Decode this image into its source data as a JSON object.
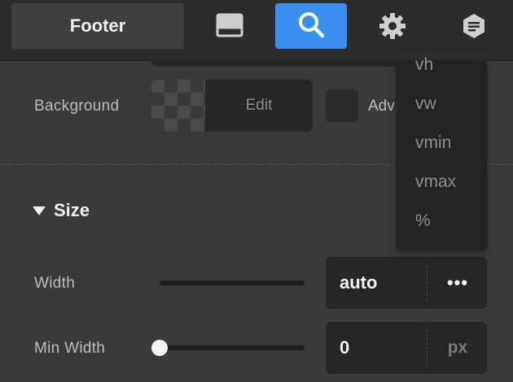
{
  "toolbar": {
    "footer_tab": "Footer",
    "icons": [
      "panel-layout-icon",
      "search-icon",
      "gear-icon",
      "document-icon"
    ],
    "accent": "#3b8ff0"
  },
  "background": {
    "label": "Background",
    "edit_label": "Edit",
    "advanced_label": "Adv"
  },
  "size_section": {
    "title": "Size",
    "width": {
      "label": "Width",
      "value": "auto",
      "unit_label": "•••"
    },
    "min_width": {
      "label": "Min Width",
      "value": "0",
      "unit_label": "px",
      "slider_fraction": 0
    }
  },
  "unit_menu": {
    "items": [
      "vh",
      "vw",
      "vmin",
      "vmax",
      "%"
    ]
  }
}
